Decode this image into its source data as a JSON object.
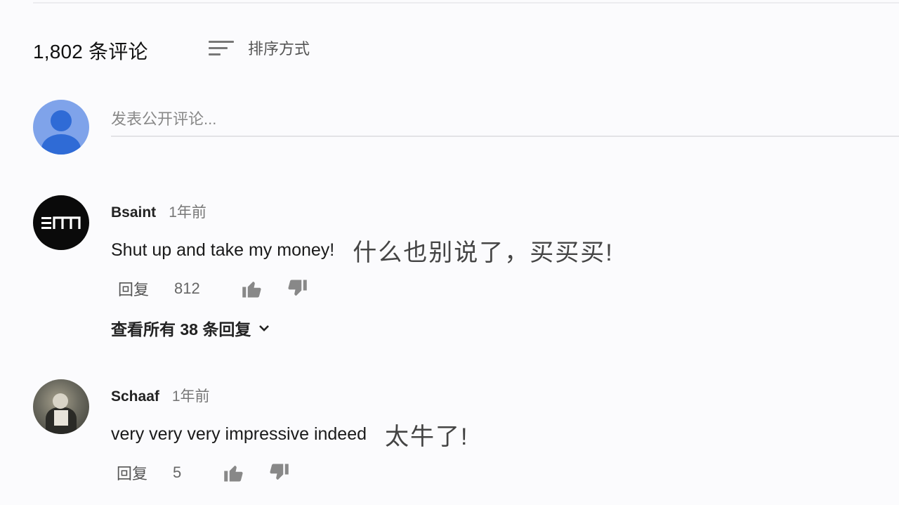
{
  "header": {
    "comment_count": "1,802 条评论",
    "sort_label": "排序方式"
  },
  "composer": {
    "placeholder": "发表公开评论..."
  },
  "comments": [
    {
      "author": "Bsaint",
      "time": "1年前",
      "text": "Shut up and take my money!",
      "translation": "什么也别说了，买买买!",
      "reply_label": "回复",
      "likes": "812",
      "view_replies": "查看所有 38 条回复"
    },
    {
      "author": "Schaaf",
      "time": "1年前",
      "text": "very very very impressive indeed",
      "translation": "太牛了!",
      "reply_label": "回复",
      "likes": "5"
    }
  ],
  "icons": {
    "sort": "sort-icon",
    "like": "thumb-up-icon",
    "dislike": "thumb-down-icon",
    "expand": "chevron-down-icon"
  },
  "colors": {
    "background": "#fbfbfd",
    "avatar_blue": "#7fa3ea",
    "avatar_blue_dark": "#2f6bd6",
    "icon_gray": "#888888"
  }
}
